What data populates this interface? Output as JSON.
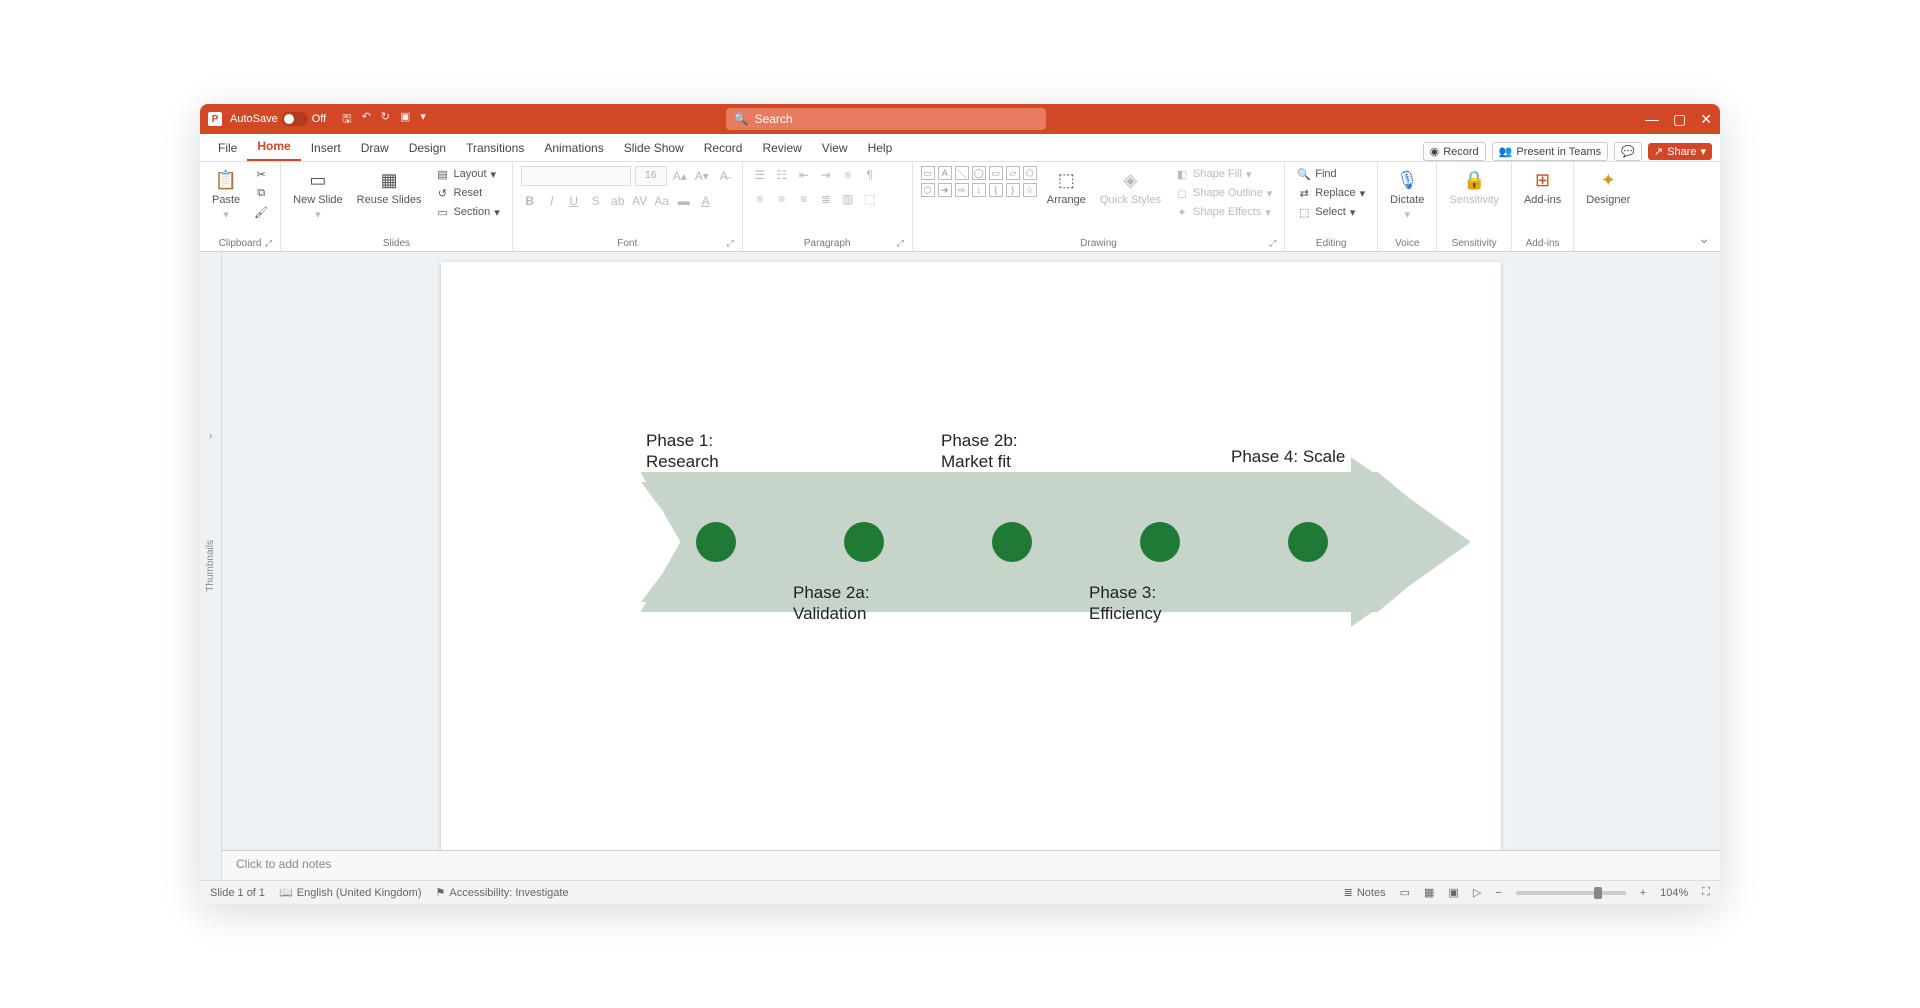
{
  "titlebar": {
    "autosave_label": "AutoSave",
    "autosave_state": "Off",
    "search_placeholder": "Search"
  },
  "tabs": [
    "File",
    "Home",
    "Insert",
    "Draw",
    "Design",
    "Transitions",
    "Animations",
    "Slide Show",
    "Record",
    "Review",
    "View",
    "Help"
  ],
  "active_tab": "Home",
  "rightcmds": {
    "record": "Record",
    "present": "Present in Teams",
    "share": "Share"
  },
  "ribbon": {
    "clipboard": {
      "paste": "Paste",
      "label": "Clipboard"
    },
    "slides": {
      "new": "New Slide",
      "reuse": "Reuse Slides",
      "layout": "Layout",
      "reset": "Reset",
      "section": "Section",
      "label": "Slides"
    },
    "font": {
      "size": "16",
      "label": "Font"
    },
    "paragraph": {
      "label": "Paragraph"
    },
    "drawing": {
      "arrange": "Arrange",
      "quick": "Quick Styles",
      "fill": "Shape Fill",
      "outline": "Shape Outline",
      "effects": "Shape Effects",
      "label": "Drawing"
    },
    "editing": {
      "find": "Find",
      "replace": "Replace",
      "select": "Select",
      "label": "Editing"
    },
    "voice": {
      "dictate": "Dictate",
      "label": "Voice"
    },
    "sensitivity": {
      "btn": "Sensitivity",
      "label": "Sensitivity"
    },
    "addins": {
      "btn": "Add-ins",
      "label": "Add-ins"
    },
    "designer": {
      "btn": "Designer"
    }
  },
  "thumb_label": "Thumbnails",
  "slide": {
    "phases": {
      "p1": "Phase 1:\nResearch",
      "p2a": "Phase 2a:\nValidation",
      "p2b": "Phase 2b:\nMarket fit",
      "p3": "Phase 3:\nEfficiency",
      "p4": "Phase 4: Scale"
    }
  },
  "notes_placeholder": "Click to add notes",
  "status": {
    "slide": "Slide 1 of 1",
    "lang": "English (United Kingdom)",
    "access": "Accessibility: Investigate",
    "notes": "Notes",
    "zoom": "104%"
  }
}
